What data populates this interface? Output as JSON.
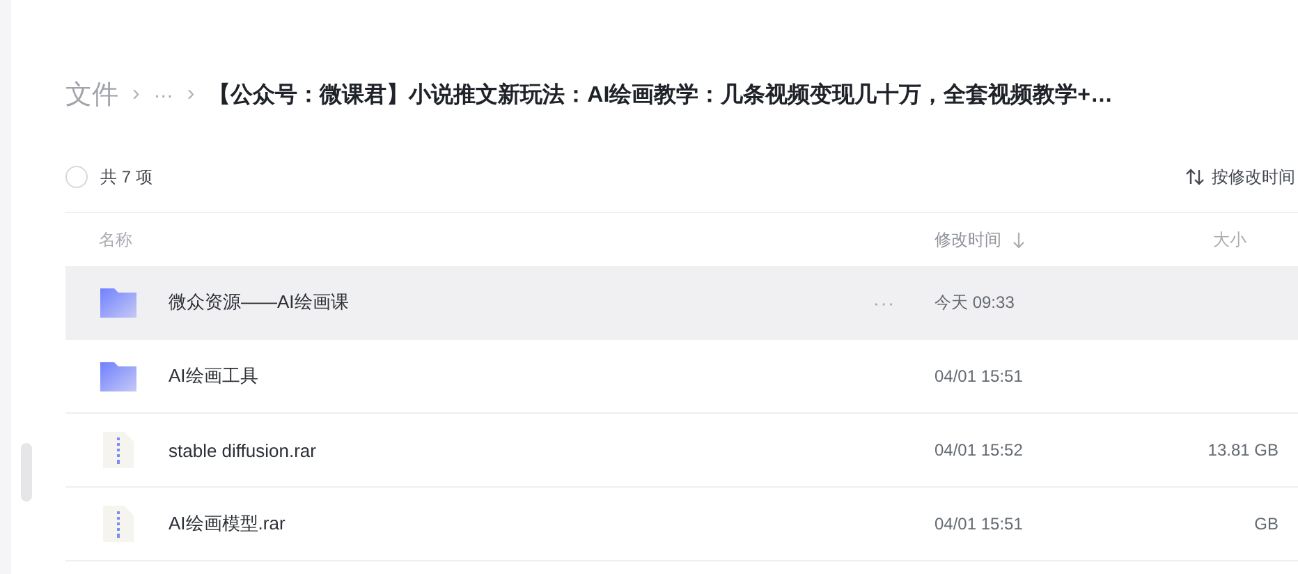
{
  "breadcrumb": {
    "root": "文件",
    "separators": [
      "›",
      "›"
    ],
    "ellipsis": "···",
    "current": "【公众号：微课君】小说推文新玩法：AI绘画教学：几条视频变现几十万，全套视频教学+…"
  },
  "summary": {
    "count_label": "共 7 项",
    "select_all_checked": false,
    "sort_label": "按修改时间"
  },
  "table": {
    "columns": [
      {
        "label": "名称",
        "sorted": false
      },
      {
        "label": "修改时间",
        "sorted": true
      },
      {
        "label": "大小",
        "sorted": false
      }
    ],
    "rows": [
      {
        "kind": "folder",
        "name": "微众资源——AI绘画课",
        "more": "···",
        "modified": "今天 09:33",
        "selected": true
      },
      {
        "kind": "folder",
        "name": "AI绘画工具",
        "modified": "04/01 15:51",
        "selected": false
      },
      {
        "kind": "archive",
        "name": "stable diffusion.rar",
        "modified": "04/01 15:52",
        "size": "13.81 GB",
        "selected": false
      },
      {
        "kind": "archive",
        "name": "AI绘画模型.rar",
        "modified": "04/01 15:51",
        "size": "GB",
        "selected": false
      }
    ]
  }
}
